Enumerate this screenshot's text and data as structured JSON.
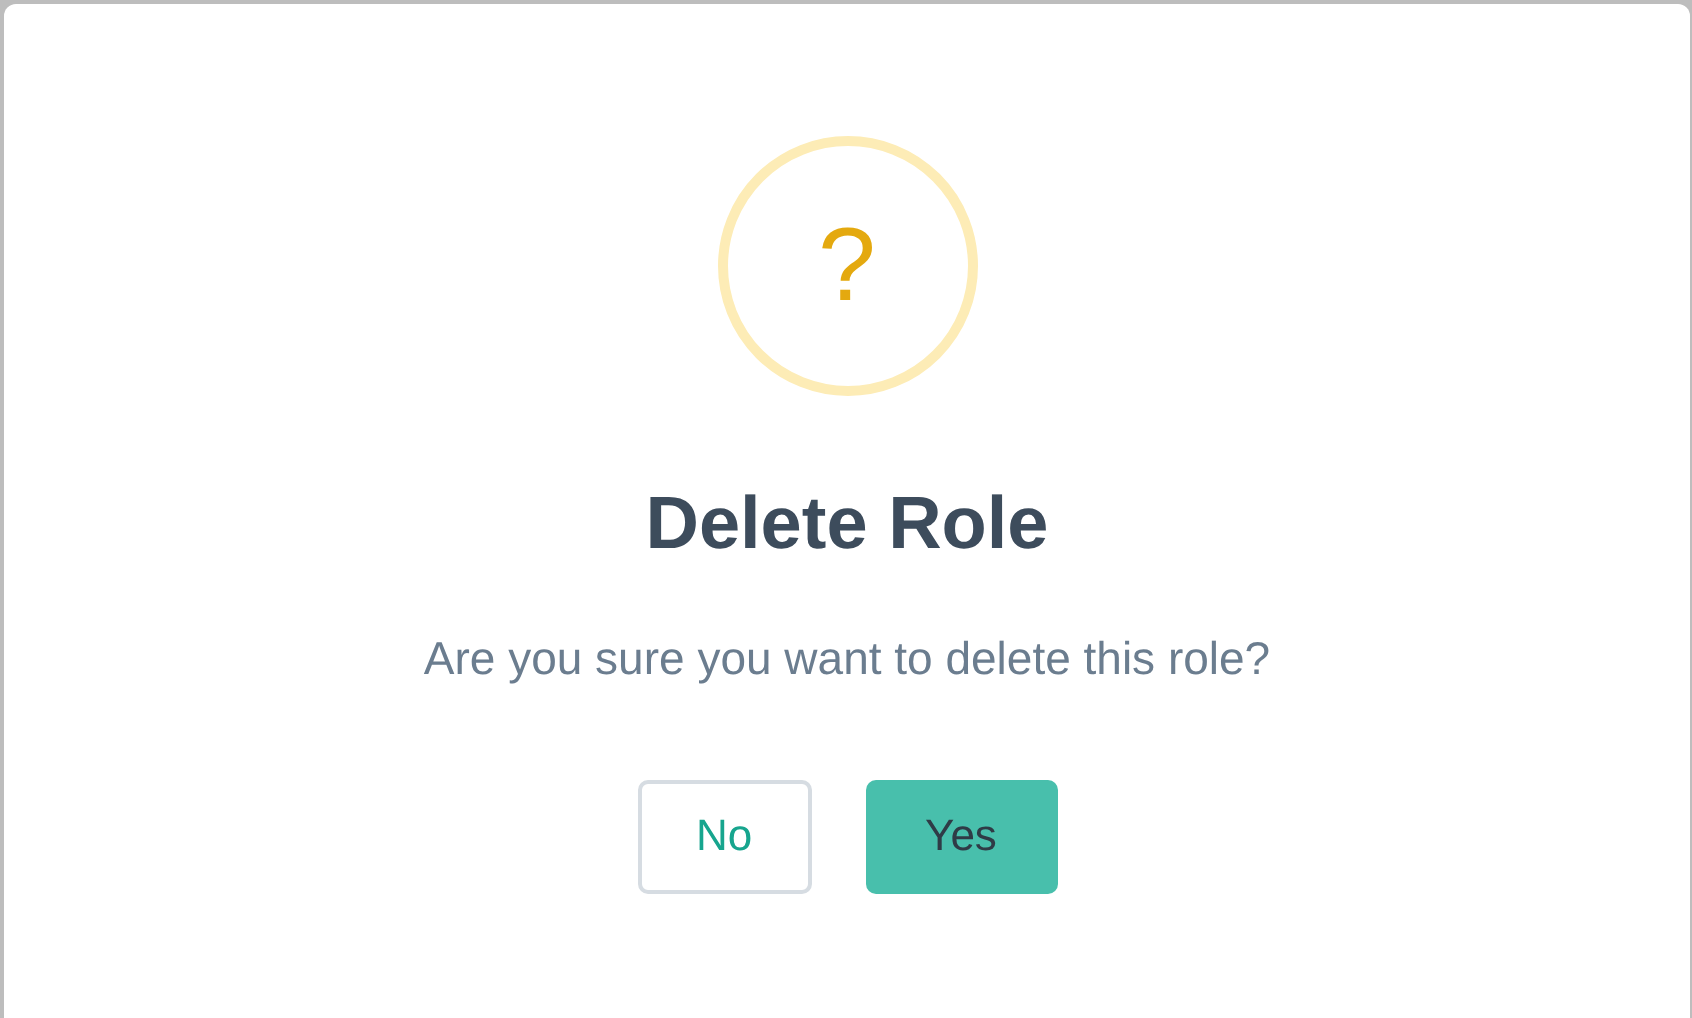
{
  "dialog": {
    "icon": "?",
    "title": "Delete Role",
    "message": "Are you sure you want to delete this role?",
    "buttons": [
      {
        "label": "No",
        "kind": "cancel"
      },
      {
        "label": "Yes",
        "kind": "confirm"
      }
    ]
  }
}
